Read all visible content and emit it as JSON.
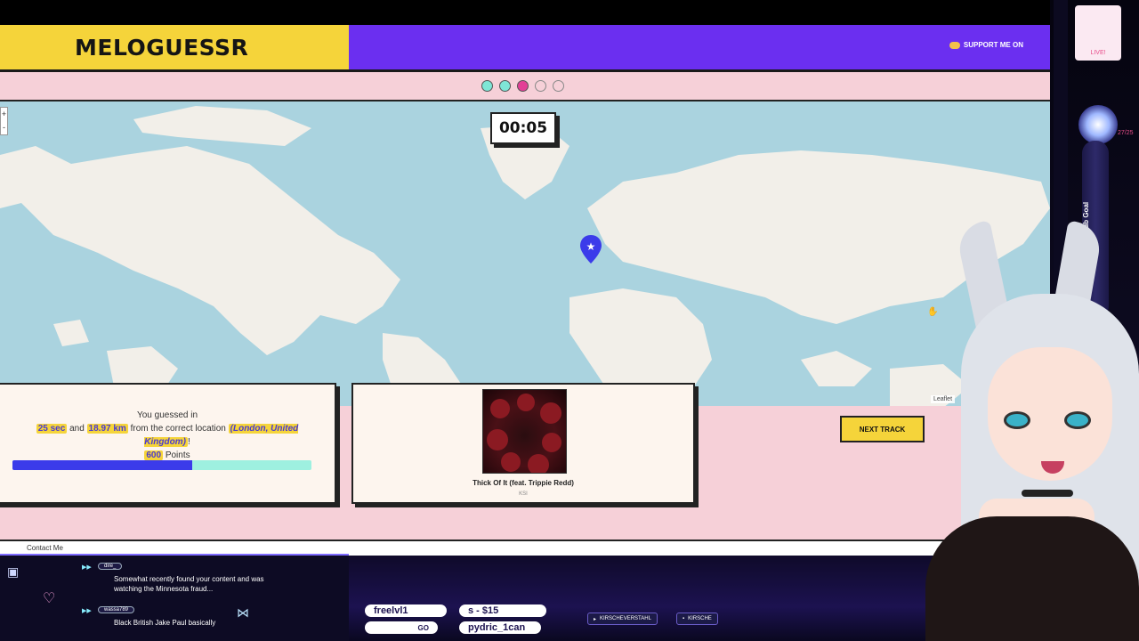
{
  "header": {
    "title": "MELOGUESSR",
    "support_label": "SUPPORT ME ON"
  },
  "progress_dots": [
    "done",
    "done",
    "current",
    "empty",
    "empty"
  ],
  "map": {
    "zoom_in": "+",
    "zoom_out": "-",
    "timer": "00:05",
    "attribution": "Leaflet"
  },
  "result": {
    "line1": "You guessed in",
    "time": "25 sec",
    "and": "and",
    "distance": "18.97 km",
    "from_text": "from the correct location",
    "location": "(London, United Kingdom)",
    "exclaim": "!",
    "points": "600",
    "points_label": "Points",
    "score_fraction": 0.6
  },
  "track": {
    "title": "Thick Of It (feat. Trippie Redd)",
    "artist": "KSI"
  },
  "next_button": "NEXT TRACK",
  "footer": {
    "contact": "Contact Me"
  },
  "chat": [
    {
      "user": "dire_",
      "message": "Somewhat recently found your content and was watching the Minnesota fraud..."
    },
    {
      "user": "wassa789",
      "message": "Black British Jake Paul basically"
    }
  ],
  "stream": {
    "latest_follower": "freelvl1",
    "latest_donation": "s - $15",
    "latest_sub": "pydric_1can",
    "go_label": "GO",
    "social_1": "KIRSCHEVERSTAHL",
    "social_2": "KIRSCHE",
    "live_label": "LIVE!",
    "sub_goal_label": "Sub Goal",
    "sub_goal_count": "27/25"
  },
  "colors": {
    "brand_yellow": "#f5d43a",
    "brand_purple": "#6b2ff0",
    "pink_bg": "#f6d0d8",
    "map_water": "#aad3df",
    "map_land": "#f2efe9",
    "progress_blue": "#3b3bea",
    "progress_teal": "#9ef0e0"
  }
}
